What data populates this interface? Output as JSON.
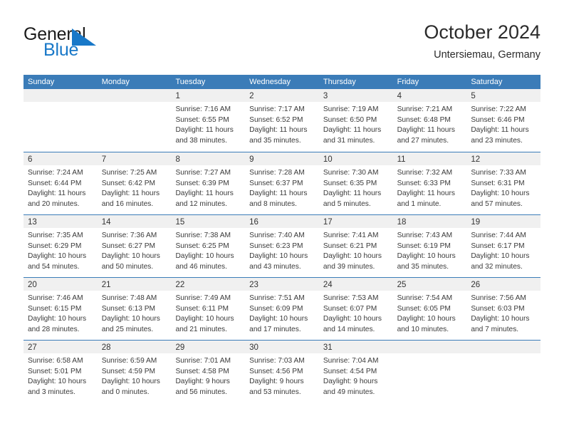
{
  "brand": {
    "name_part1": "General",
    "name_part2": "Blue",
    "logo_icon": "triangle-flag-mark",
    "color_dark": "#1b1b1b",
    "color_blue": "#1878c8"
  },
  "header": {
    "title": "October 2024",
    "subtitle": "Untersiemau, Germany"
  },
  "theme": {
    "header_blue": "#3b7cb8",
    "day_band_gray": "#f0f0f0",
    "text": "#3a3a3a"
  },
  "weekdays": [
    "Sunday",
    "Monday",
    "Tuesday",
    "Wednesday",
    "Thursday",
    "Friday",
    "Saturday"
  ],
  "labels": {
    "sunrise": "Sunrise:",
    "sunset": "Sunset:",
    "daylight": "Daylight:"
  },
  "weeks": [
    [
      {
        "day": "",
        "empty": true,
        "sunrise": "",
        "sunset": "",
        "daylight": ""
      },
      {
        "day": "",
        "empty": true,
        "sunrise": "",
        "sunset": "",
        "daylight": ""
      },
      {
        "day": "1",
        "sunrise": "Sunrise: 7:16 AM",
        "sunset": "Sunset: 6:55 PM",
        "daylight": "Daylight: 11 hours and 38 minutes."
      },
      {
        "day": "2",
        "sunrise": "Sunrise: 7:17 AM",
        "sunset": "Sunset: 6:52 PM",
        "daylight": "Daylight: 11 hours and 35 minutes."
      },
      {
        "day": "3",
        "sunrise": "Sunrise: 7:19 AM",
        "sunset": "Sunset: 6:50 PM",
        "daylight": "Daylight: 11 hours and 31 minutes."
      },
      {
        "day": "4",
        "sunrise": "Sunrise: 7:21 AM",
        "sunset": "Sunset: 6:48 PM",
        "daylight": "Daylight: 11 hours and 27 minutes."
      },
      {
        "day": "5",
        "sunrise": "Sunrise: 7:22 AM",
        "sunset": "Sunset: 6:46 PM",
        "daylight": "Daylight: 11 hours and 23 minutes."
      }
    ],
    [
      {
        "day": "6",
        "sunrise": "Sunrise: 7:24 AM",
        "sunset": "Sunset: 6:44 PM",
        "daylight": "Daylight: 11 hours and 20 minutes."
      },
      {
        "day": "7",
        "sunrise": "Sunrise: 7:25 AM",
        "sunset": "Sunset: 6:42 PM",
        "daylight": "Daylight: 11 hours and 16 minutes."
      },
      {
        "day": "8",
        "sunrise": "Sunrise: 7:27 AM",
        "sunset": "Sunset: 6:39 PM",
        "daylight": "Daylight: 11 hours and 12 minutes."
      },
      {
        "day": "9",
        "sunrise": "Sunrise: 7:28 AM",
        "sunset": "Sunset: 6:37 PM",
        "daylight": "Daylight: 11 hours and 8 minutes."
      },
      {
        "day": "10",
        "sunrise": "Sunrise: 7:30 AM",
        "sunset": "Sunset: 6:35 PM",
        "daylight": "Daylight: 11 hours and 5 minutes."
      },
      {
        "day": "11",
        "sunrise": "Sunrise: 7:32 AM",
        "sunset": "Sunset: 6:33 PM",
        "daylight": "Daylight: 11 hours and 1 minute."
      },
      {
        "day": "12",
        "sunrise": "Sunrise: 7:33 AM",
        "sunset": "Sunset: 6:31 PM",
        "daylight": "Daylight: 10 hours and 57 minutes."
      }
    ],
    [
      {
        "day": "13",
        "sunrise": "Sunrise: 7:35 AM",
        "sunset": "Sunset: 6:29 PM",
        "daylight": "Daylight: 10 hours and 54 minutes."
      },
      {
        "day": "14",
        "sunrise": "Sunrise: 7:36 AM",
        "sunset": "Sunset: 6:27 PM",
        "daylight": "Daylight: 10 hours and 50 minutes."
      },
      {
        "day": "15",
        "sunrise": "Sunrise: 7:38 AM",
        "sunset": "Sunset: 6:25 PM",
        "daylight": "Daylight: 10 hours and 46 minutes."
      },
      {
        "day": "16",
        "sunrise": "Sunrise: 7:40 AM",
        "sunset": "Sunset: 6:23 PM",
        "daylight": "Daylight: 10 hours and 43 minutes."
      },
      {
        "day": "17",
        "sunrise": "Sunrise: 7:41 AM",
        "sunset": "Sunset: 6:21 PM",
        "daylight": "Daylight: 10 hours and 39 minutes."
      },
      {
        "day": "18",
        "sunrise": "Sunrise: 7:43 AM",
        "sunset": "Sunset: 6:19 PM",
        "daylight": "Daylight: 10 hours and 35 minutes."
      },
      {
        "day": "19",
        "sunrise": "Sunrise: 7:44 AM",
        "sunset": "Sunset: 6:17 PM",
        "daylight": "Daylight: 10 hours and 32 minutes."
      }
    ],
    [
      {
        "day": "20",
        "sunrise": "Sunrise: 7:46 AM",
        "sunset": "Sunset: 6:15 PM",
        "daylight": "Daylight: 10 hours and 28 minutes."
      },
      {
        "day": "21",
        "sunrise": "Sunrise: 7:48 AM",
        "sunset": "Sunset: 6:13 PM",
        "daylight": "Daylight: 10 hours and 25 minutes."
      },
      {
        "day": "22",
        "sunrise": "Sunrise: 7:49 AM",
        "sunset": "Sunset: 6:11 PM",
        "daylight": "Daylight: 10 hours and 21 minutes."
      },
      {
        "day": "23",
        "sunrise": "Sunrise: 7:51 AM",
        "sunset": "Sunset: 6:09 PM",
        "daylight": "Daylight: 10 hours and 17 minutes."
      },
      {
        "day": "24",
        "sunrise": "Sunrise: 7:53 AM",
        "sunset": "Sunset: 6:07 PM",
        "daylight": "Daylight: 10 hours and 14 minutes."
      },
      {
        "day": "25",
        "sunrise": "Sunrise: 7:54 AM",
        "sunset": "Sunset: 6:05 PM",
        "daylight": "Daylight: 10 hours and 10 minutes."
      },
      {
        "day": "26",
        "sunrise": "Sunrise: 7:56 AM",
        "sunset": "Sunset: 6:03 PM",
        "daylight": "Daylight: 10 hours and 7 minutes."
      }
    ],
    [
      {
        "day": "27",
        "sunrise": "Sunrise: 6:58 AM",
        "sunset": "Sunset: 5:01 PM",
        "daylight": "Daylight: 10 hours and 3 minutes."
      },
      {
        "day": "28",
        "sunrise": "Sunrise: 6:59 AM",
        "sunset": "Sunset: 4:59 PM",
        "daylight": "Daylight: 10 hours and 0 minutes."
      },
      {
        "day": "29",
        "sunrise": "Sunrise: 7:01 AM",
        "sunset": "Sunset: 4:58 PM",
        "daylight": "Daylight: 9 hours and 56 minutes."
      },
      {
        "day": "30",
        "sunrise": "Sunrise: 7:03 AM",
        "sunset": "Sunset: 4:56 PM",
        "daylight": "Daylight: 9 hours and 53 minutes."
      },
      {
        "day": "31",
        "sunrise": "Sunrise: 7:04 AM",
        "sunset": "Sunset: 4:54 PM",
        "daylight": "Daylight: 9 hours and 49 minutes."
      },
      {
        "day": "",
        "empty": true,
        "sunrise": "",
        "sunset": "",
        "daylight": ""
      },
      {
        "day": "",
        "empty": true,
        "sunrise": "",
        "sunset": "",
        "daylight": ""
      }
    ]
  ]
}
